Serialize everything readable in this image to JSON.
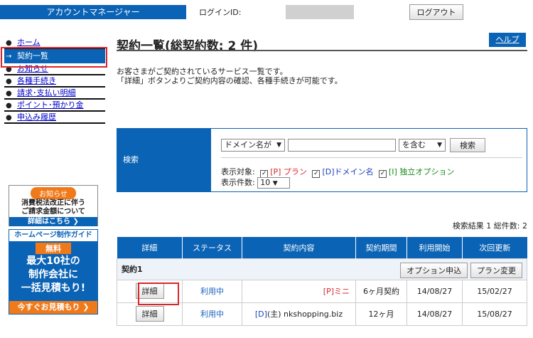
{
  "header": {
    "account_tab": "アカウントマネージャー",
    "login_label": "ログインID:",
    "logout_label": "ログアウト"
  },
  "sidebar": {
    "items": [
      {
        "bullet": "●",
        "label": "ホーム"
      },
      {
        "bullet": "→",
        "label": "契約一覧"
      },
      {
        "bullet": "●",
        "label": "お知らせ"
      },
      {
        "bullet": "●",
        "label": "各種手続き"
      },
      {
        "bullet": "●",
        "label": "請求･支払い明細"
      },
      {
        "bullet": "●",
        "label": "ポイント･預かり金"
      },
      {
        "bullet": "●",
        "label": "申込み履歴"
      }
    ],
    "banner1": {
      "pill": "お知らせ",
      "line1": "消費税法改正に伴う",
      "line2": "ご請求金額について",
      "cta": "詳細はこちら ❯"
    },
    "banner2": {
      "head": "ホームページ制作ガイド",
      "free": "無料",
      "line1": "最大10社の",
      "line2": "制作会社に",
      "line3": "一括見積もり!",
      "cta": "今すぐお見積もり ❯"
    }
  },
  "main": {
    "title": "契約一覧(総契約数: 2 件)",
    "help": "ヘルプ",
    "desc_line1": "お客さまがご契約されているサービス一覧です。",
    "desc_line2": "「詳細」ボタンよりご契約内容の確認、各種手続きが可能です。"
  },
  "search": {
    "label": "検索",
    "field_select": "ドメイン名が",
    "keyword": "",
    "match_select": "を含む",
    "button": "検索",
    "display_target_label": "表示対象:",
    "opt_plan": "[P] プラン",
    "opt_domain": "[D]ドメイン名",
    "opt_option": "[I] 独立オプション",
    "count_label": "表示件数:",
    "count_value": "10"
  },
  "results": {
    "summary": "検索結果 1  総件数: 2"
  },
  "table": {
    "headers": [
      "詳細",
      "ステータス",
      "契約内容",
      "契約期間",
      "利用開始",
      "次回更新"
    ],
    "group_label": "契約1",
    "group_btn_option": "オプション申込",
    "group_btn_plan": "プラン変更",
    "rows": [
      {
        "detail": "詳細",
        "status": "利用中",
        "content_tag": "[P]",
        "content": "ミニ",
        "period": "6ヶ月契約",
        "start": "14/08/27",
        "renew": "15/02/27"
      },
      {
        "detail": "詳細",
        "status": "利用中",
        "content_tag": "[D]",
        "content": "(主) nkshopping.biz",
        "period": "12ヶ月",
        "start": "14/08/27",
        "renew": "15/08/27"
      }
    ]
  },
  "colors": {
    "brand_blue": "#0b63b5",
    "highlight_red": "#d9262b",
    "banner_orange": "#f07a1a"
  }
}
